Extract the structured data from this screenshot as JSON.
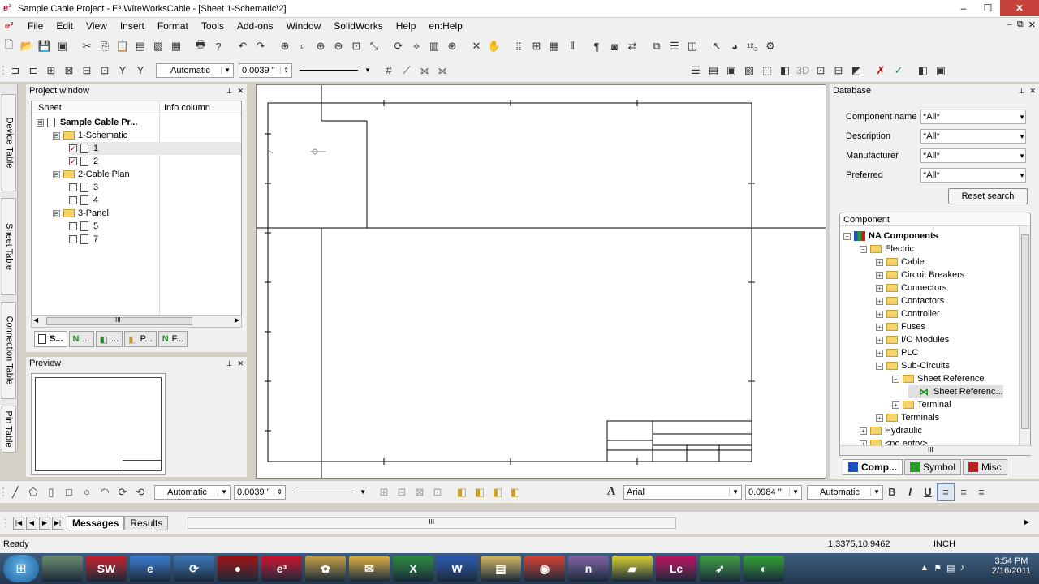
{
  "window": {
    "title": "Sample Cable Project - E³.WireWorksCable - [Sheet 1-Schematic\\2]",
    "app_logo": "e³",
    "controls": [
      "–",
      "☐",
      "✕"
    ],
    "mdi_controls": [
      "–",
      "⧉",
      "✕"
    ]
  },
  "menu": {
    "items": [
      "File",
      "Edit",
      "View",
      "Insert",
      "Format",
      "Tools",
      "Add-ons",
      "Window",
      "SolidWorks",
      "Help",
      "en:Help"
    ]
  },
  "toolbar2": {
    "line_width_mode": "Automatic",
    "line_width": "0.0039 \"",
    "three_d": "3D"
  },
  "vertical_tabs": [
    "Device Table",
    "Sheet Table",
    "Connection Table",
    "Pin Table"
  ],
  "project_window": {
    "title": "Project window",
    "columns": [
      "Sheet",
      "Info column"
    ],
    "tree": [
      {
        "label": "Sample Cable Pr...",
        "level": 0,
        "bold": true,
        "expander": "⊟"
      },
      {
        "label": "1-Schematic",
        "level": 1,
        "expander": "⊟",
        "folder": true
      },
      {
        "label": "1",
        "level": 2,
        "checked": true
      },
      {
        "label": "2",
        "level": 2,
        "checked": true
      },
      {
        "label": "2-Cable Plan",
        "level": 1,
        "expander": "⊟",
        "folder": true
      },
      {
        "label": "3",
        "level": 2,
        "checked": false
      },
      {
        "label": "4",
        "level": 2,
        "checked": false
      },
      {
        "label": "3-Panel",
        "level": 1,
        "expander": "⊟",
        "folder": true
      },
      {
        "label": "5",
        "level": 2,
        "checked": false
      },
      {
        "label": "7",
        "level": 2,
        "checked": false
      }
    ],
    "scroll_grip": "III",
    "tabs": [
      {
        "label": "S...",
        "active": true
      },
      {
        "label": "...",
        "active": false
      },
      {
        "label": "...",
        "active": false
      },
      {
        "label": "P...",
        "active": false
      },
      {
        "label": "F...",
        "active": false
      }
    ]
  },
  "preview": {
    "title": "Preview"
  },
  "database": {
    "title": "Database",
    "fields": [
      {
        "label": "Component name",
        "value": "*All*"
      },
      {
        "label": "Description",
        "value": "*All*"
      },
      {
        "label": "Manufacturer",
        "value": "*All*"
      },
      {
        "label": "Preferred",
        "value": "*All*"
      }
    ],
    "reset_label": "Reset search",
    "component_header": "Component",
    "tree": [
      {
        "label": "NA Components",
        "level": 0,
        "expander": "⊟",
        "bold": true
      },
      {
        "label": "Electric",
        "level": 1,
        "expander": "⊟"
      },
      {
        "label": "Cable",
        "level": 2,
        "expander": "⊞"
      },
      {
        "label": "Circuit Breakers",
        "level": 2,
        "expander": "⊞"
      },
      {
        "label": "Connectors",
        "level": 2,
        "expander": "⊞"
      },
      {
        "label": "Contactors",
        "level": 2,
        "expander": "⊞"
      },
      {
        "label": "Controller",
        "level": 2,
        "expander": "⊞"
      },
      {
        "label": "Fuses",
        "level": 2,
        "expander": "⊞"
      },
      {
        "label": "I/O Modules",
        "level": 2,
        "expander": "⊞"
      },
      {
        "label": "PLC",
        "level": 2,
        "expander": "⊞"
      },
      {
        "label": "Sub-Circuits",
        "level": 2,
        "expander": "⊟"
      },
      {
        "label": "Sheet Reference",
        "level": 3,
        "expander": "⊟"
      },
      {
        "label": "Sheet Referenc...",
        "level": 4,
        "expander": "",
        "selected": true
      },
      {
        "label": "Terminal",
        "level": 3,
        "expander": "⊞"
      },
      {
        "label": "Terminals",
        "level": 2,
        "expander": "⊞"
      },
      {
        "label": "Hydraulic",
        "level": 1,
        "expander": "⊞"
      },
      {
        "label": "<no entry>",
        "level": 1,
        "expander": "⊞"
      }
    ],
    "scroll_grip": "III",
    "tabs": [
      {
        "label": "Comp...",
        "active": true,
        "color": "#1a4fd0"
      },
      {
        "label": "Symbol",
        "active": false,
        "color": "#2a9a2a"
      },
      {
        "label": "Misc",
        "active": false,
        "color": "#c02020"
      }
    ]
  },
  "bottom_toolbar": {
    "line_width_mode": "Automatic",
    "line_width": "0.0039 \"",
    "text_icon": "A",
    "font": "Arial",
    "font_size": "0.0984 \"",
    "text_color_mode": "Automatic",
    "bold": "B",
    "italic": "I",
    "underline": "U"
  },
  "messages": {
    "tabs": [
      {
        "label": "Messages",
        "active": true
      },
      {
        "label": "Results",
        "active": false
      }
    ],
    "nav": [
      "|◀",
      "◀",
      "▶",
      "▶|"
    ],
    "scroll_grip": "III"
  },
  "status": {
    "left": "Ready",
    "coords": "1.3375,10.9462",
    "units": "INCH"
  },
  "taskbar": {
    "time": "3:54 PM",
    "date": "2/16/2011",
    "apps": [
      {
        "name": "evernote",
        "label": "",
        "color": "#6b8a6a"
      },
      {
        "name": "solidworks",
        "label": "SW",
        "color": "#c8202a"
      },
      {
        "name": "ie",
        "label": "e",
        "color": "#3a7ad0"
      },
      {
        "name": "network",
        "label": "⟳",
        "color": "#3c78b8"
      },
      {
        "name": "record",
        "label": "●",
        "color": "#a01010"
      },
      {
        "name": "e3",
        "label": "e³",
        "color": "#d0102a"
      },
      {
        "name": "paint",
        "label": "✿",
        "color": "#c8a040"
      },
      {
        "name": "outlook",
        "label": "✉",
        "color": "#e0b040"
      },
      {
        "name": "excel",
        "label": "X",
        "color": "#2a8a3a"
      },
      {
        "name": "word",
        "label": "W",
        "color": "#2a5ab0"
      },
      {
        "name": "explorer",
        "label": "▤",
        "color": "#d8b860"
      },
      {
        "name": "chrome",
        "label": "◉",
        "color": "#d84030"
      },
      {
        "name": "onenote",
        "label": "n",
        "color": "#8060a0"
      },
      {
        "name": "notes",
        "label": "▰",
        "color": "#d8d030"
      },
      {
        "name": "livecycle",
        "label": "Lc",
        "color": "#c01060"
      },
      {
        "name": "app2",
        "label": "➶",
        "color": "#40a040"
      },
      {
        "name": "app3",
        "label": "◐",
        "color": "#30a030"
      }
    ]
  }
}
